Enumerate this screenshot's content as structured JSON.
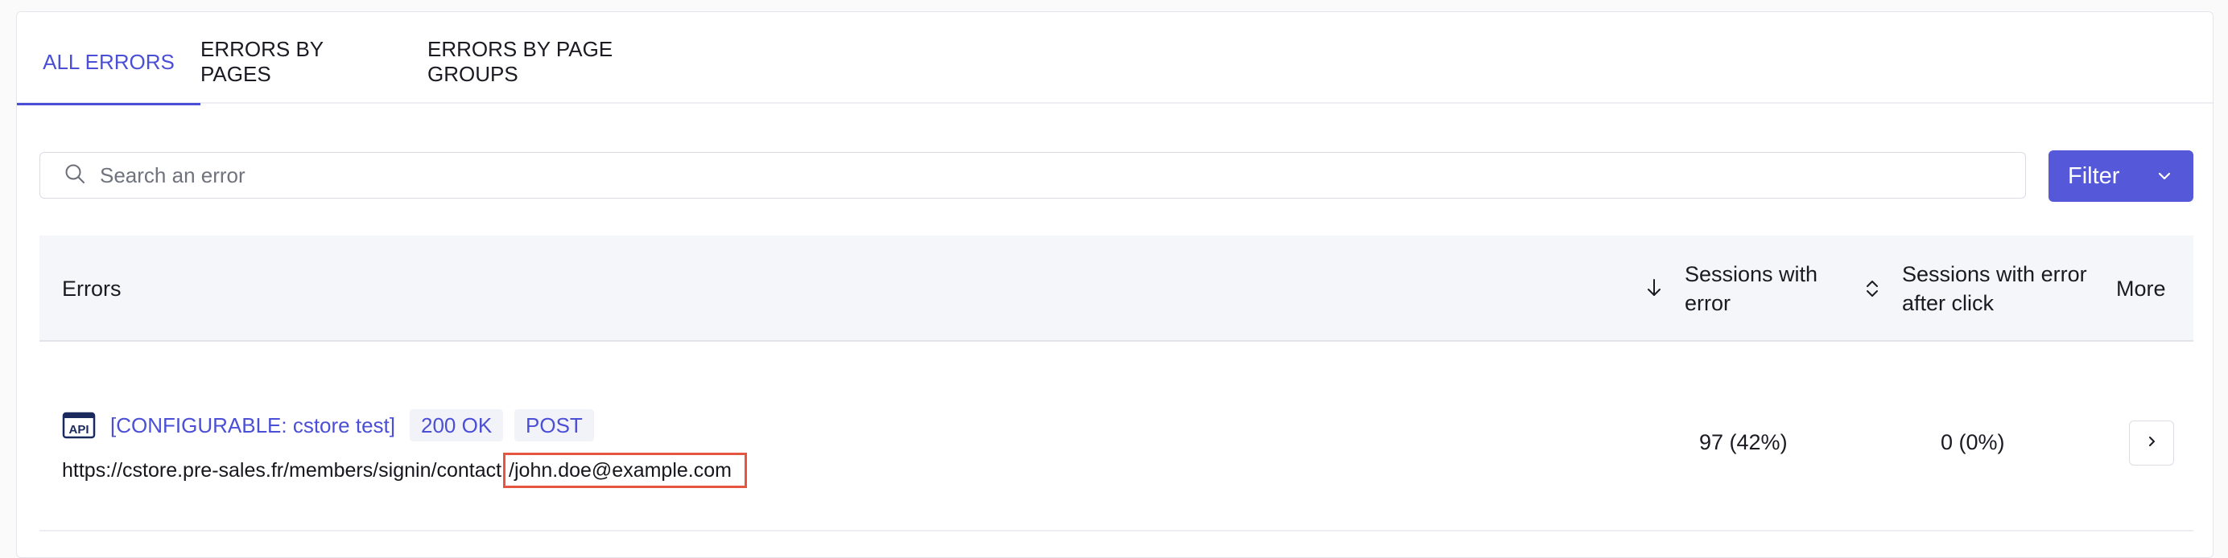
{
  "tabs": [
    {
      "label": "ALL ERRORS",
      "active": true
    },
    {
      "label": "ERRORS BY PAGES",
      "active": false
    },
    {
      "label": "ERRORS BY PAGE GROUPS",
      "active": false
    }
  ],
  "search": {
    "placeholder": "Search an error",
    "value": ""
  },
  "filter": {
    "label": "Filter"
  },
  "table": {
    "headers": {
      "errors": "Errors",
      "sessions_with_error": "Sessions with error",
      "sessions_with_error_after_click": "Sessions with error after click",
      "more": "More"
    },
    "rows": [
      {
        "icon": "api-icon",
        "title": "[CONFIGURABLE: cstore test]",
        "status": "200 OK",
        "method": "POST",
        "url_prefix": "https://cstore.pre-sales.fr/members/signin/contact",
        "url_highlight": "/john.doe@example.com",
        "sessions_with_error": "97 (42%)",
        "sessions_with_error_after_click": "0 (0%)"
      }
    ]
  },
  "colors": {
    "accent": "#4b4fd6",
    "button_bg": "#5559d9",
    "highlight_border": "#e4563f",
    "header_bg": "#f4f6fa"
  },
  "icons": {
    "search": "search-icon",
    "filter_dropdown": "chevron-down-icon",
    "sort_desc": "arrow-down-icon",
    "sort_both": "sort-updown-icon",
    "more": "chevron-right-icon"
  }
}
